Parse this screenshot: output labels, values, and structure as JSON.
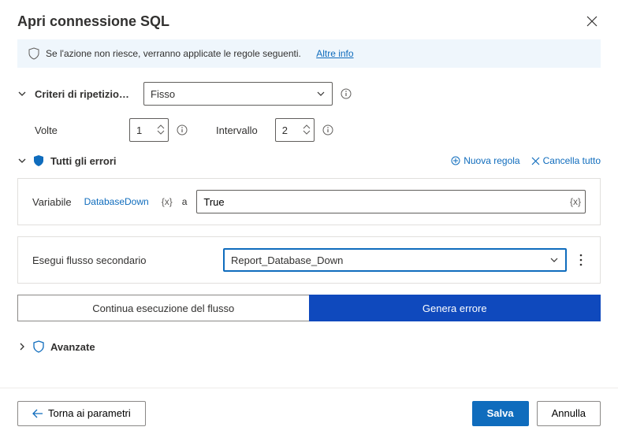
{
  "dialog": {
    "title": "Apri connessione SQL",
    "notice_text": "Se l'azione non riesce, verranno applicate le regole seguenti.",
    "notice_link": "Altre info"
  },
  "retry": {
    "criteria_label": "Criteri di ripetizio…",
    "criteria_value": "Fisso",
    "times_label": "Volte",
    "times_value": "1",
    "interval_label": "Intervallo",
    "interval_value": "2"
  },
  "errors": {
    "title": "Tutti gli errori",
    "new_rule_label": "Nuova regola",
    "clear_all_label": "Cancella tutto"
  },
  "rule1": {
    "label": "Variabile",
    "chip": "DatabaseDown",
    "token": "{x}",
    "assign": "a",
    "value": "True"
  },
  "rule2": {
    "label": "Esegui flusso secondario",
    "value": "Report_Database_Down"
  },
  "actions": {
    "continue": "Continua esecuzione del flusso",
    "throw": "Genera errore"
  },
  "advanced": {
    "label": "Avanzate"
  },
  "footer": {
    "back": "Torna ai parametri",
    "save": "Salva",
    "cancel": "Annulla"
  },
  "colors": {
    "accent": "#0f6cbd",
    "primarybtn": "#0f49bd"
  }
}
